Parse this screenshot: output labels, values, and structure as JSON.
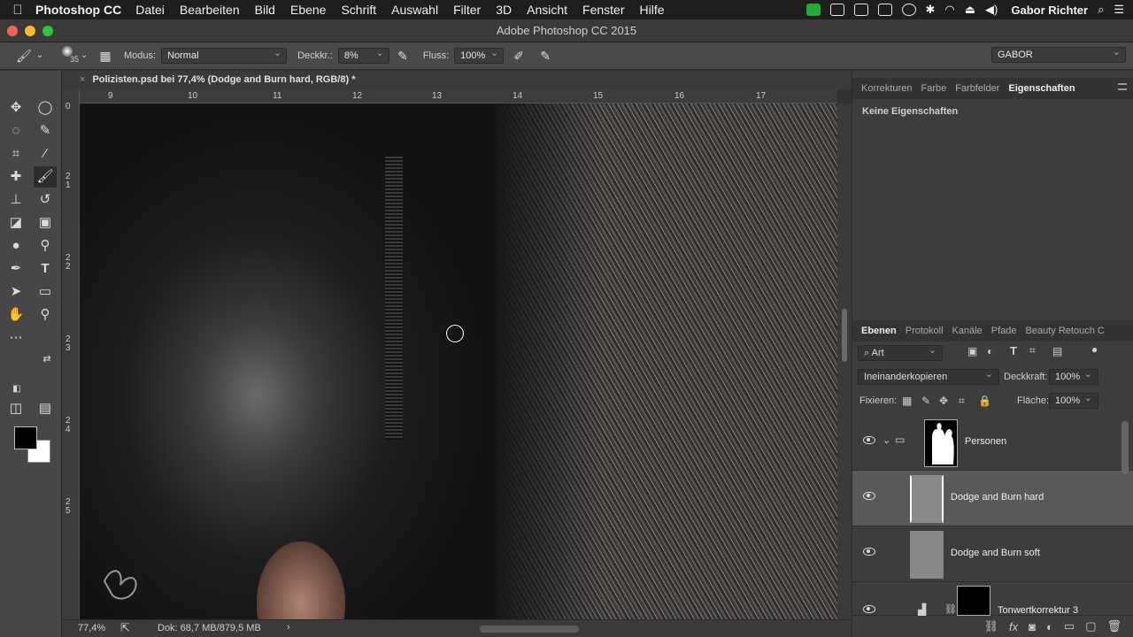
{
  "menubar": {
    "apple": "",
    "app": "Photoshop CC",
    "items": [
      "Datei",
      "Bearbeiten",
      "Bild",
      "Ebene",
      "Schrift",
      "Auswahl",
      "Filter",
      "3D",
      "Ansicht",
      "Fenster",
      "Hilfe"
    ],
    "user": "Gabor Richter"
  },
  "window": {
    "title": "Adobe Photoshop CC 2015"
  },
  "options": {
    "brush_size": "35",
    "mode_label": "Modus:",
    "mode_value": "Normal",
    "opacity_label": "Deckkr.:",
    "opacity_value": "8%",
    "flow_label": "Fluss:",
    "flow_value": "100%",
    "workspace": "GABOR"
  },
  "document": {
    "tab_title": "Polizisten.psd bei 77,4% (Dodge and Burn hard, RGB/8) *",
    "ruler_h": [
      "9",
      "10",
      "11",
      "12",
      "13",
      "14",
      "15",
      "16",
      "17"
    ],
    "ruler_v": [
      "0",
      "2\n1",
      "2\n2",
      "2\n3",
      "2\n4",
      "2\n5"
    ]
  },
  "status": {
    "zoom": "77,4%",
    "doc": "Dok: 68,7 MB/879,5 MB"
  },
  "panels": {
    "top_tabs": [
      "Korrekturen",
      "Farbe",
      "Farbfelder",
      "Eigenschaften"
    ],
    "top_active": "Eigenschaften",
    "no_properties": "Keine Eigenschaften",
    "layer_tabs": [
      "Ebenen",
      "Protokoll",
      "Kanäle",
      "Pfade",
      "Beauty Retouch C"
    ],
    "layer_active": "Ebenen",
    "filter_value": "Art",
    "blend_mode": "Ineinanderkopieren",
    "opacity_label": "Deckkraft:",
    "opacity_value": "100%",
    "lock_label": "Fixieren:",
    "fill_label": "Fläche:",
    "fill_value": "100%",
    "layers": [
      {
        "name": "Personen"
      },
      {
        "name": "Dodge and Burn hard"
      },
      {
        "name": "Dodge and Burn soft"
      },
      {
        "name": "Tonwertkorrektur 3"
      }
    ]
  },
  "colors": {
    "foreground": "#000000",
    "background": "#ffffff",
    "selected_layer": "#595959"
  }
}
